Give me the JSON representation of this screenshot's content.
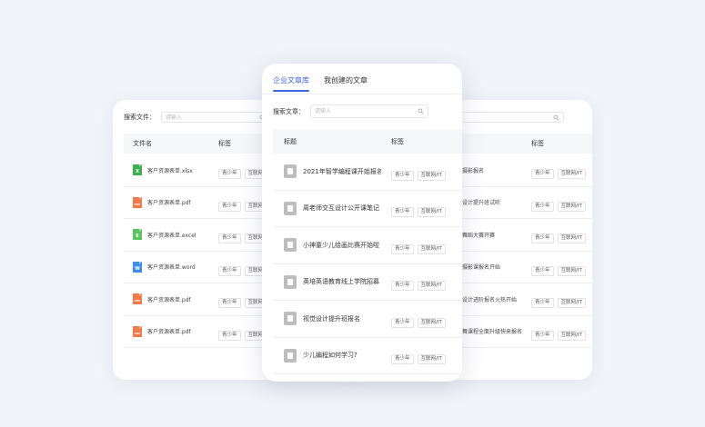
{
  "left_panel": {
    "search_label": "搜索文件：",
    "search_placeholder": "请输入",
    "columns": [
      "文件名",
      "标签"
    ],
    "rows": [
      {
        "icon": "excel-file-icon",
        "icon_letter": "X",
        "icon_color": "#3fae4e",
        "name": "客户资源表单.xlsx",
        "tags": [
          "青少年",
          "互联网/"
        ]
      },
      {
        "icon": "pdf-file-icon",
        "icon_letter": "PDF",
        "icon_color": "#f07a4a",
        "name": "客户资源表单.pdf",
        "tags": [
          "青少年",
          "互联网/"
        ]
      },
      {
        "icon": "excel-file-icon",
        "icon_letter": "E",
        "icon_color": "#5cc45e",
        "name": "客户资源表单.excel",
        "tags": [
          "青少年",
          "互联网/"
        ]
      },
      {
        "icon": "word-file-icon",
        "icon_letter": "W",
        "icon_color": "#3f8ee8",
        "name": "客户资源表单.word",
        "tags": [
          "青少年",
          "互联网/"
        ]
      },
      {
        "icon": "pdf-file-icon",
        "icon_letter": "PDF",
        "icon_color": "#f07a4a",
        "name": "客户资源表单.pdf",
        "tags": [
          "青少年",
          "互联网/"
        ]
      },
      {
        "icon": "pdf-file-icon",
        "icon_letter": "PDF",
        "icon_color": "#f07a4a",
        "name": "客户资源表单.pdf",
        "tags": [
          "青少年",
          "互联网/"
        ]
      }
    ]
  },
  "center_panel": {
    "tabs": [
      {
        "label": "企业文章库",
        "active": true
      },
      {
        "label": "我创建的文章",
        "active": false
      }
    ],
    "search_label": "搜索文章：",
    "search_placeholder": "请输入",
    "columns": [
      "标题",
      "标签"
    ],
    "rows": [
      {
        "title": "2021年智学编程课开始报名",
        "tags": [
          "青少年",
          "互联网/IT"
        ]
      },
      {
        "title": "周老师交互设计公开课笔记",
        "tags": [
          "青少年",
          "互联网/IT"
        ]
      },
      {
        "title": "小神童少儿绘画比赛开始啦",
        "tags": [
          "青少年",
          "互联网/IT"
        ]
      },
      {
        "title": "英培英语教育线上学院招募",
        "tags": [
          "青少年",
          "互联网/IT"
        ]
      },
      {
        "title": "视觉设计提升班报名",
        "tags": [
          "青少年",
          "互联网/IT"
        ]
      },
      {
        "title": "少儿编程如何学习?",
        "tags": [
          "青少年",
          "互联网/IT"
        ]
      }
    ]
  },
  "right_panel": {
    "columns": [
      "",
      "标签"
    ],
    "rows": [
      {
        "title": "摄影报名",
        "tags": [
          "青少年",
          "互联网/IT"
        ]
      },
      {
        "title": "设计提升班试听",
        "tags": [
          "青少年",
          "互联网/IT"
        ]
      },
      {
        "title": "舞蹈大赛开赛",
        "tags": [
          "青少年",
          "互联网/IT"
        ]
      },
      {
        "title": "摄影课报名开始",
        "tags": [
          "青少年",
          "互联网/IT"
        ]
      },
      {
        "title": "设计进阶报名火热开始",
        "tags": [
          "青少年",
          "互联网/IT"
        ]
      },
      {
        "title": "舞课程全面升级快来报名",
        "tags": [
          "青少年",
          "互联网/IT"
        ]
      }
    ]
  },
  "colors": {
    "accent": "#3d66e0",
    "background": "#f2f4fa"
  }
}
